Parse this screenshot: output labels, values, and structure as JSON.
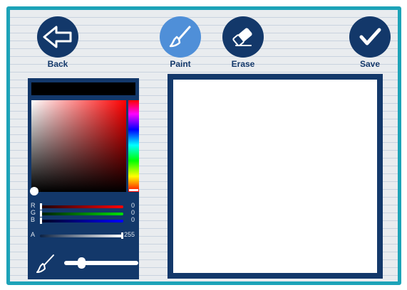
{
  "toolbar": {
    "back_label": "Back",
    "paint_label": "Paint",
    "erase_label": "Erase",
    "save_label": "Save",
    "active_tool": "paint"
  },
  "color_picker": {
    "hex_value": "",
    "channels": [
      {
        "label": "R",
        "value": "0"
      },
      {
        "label": "G",
        "value": "0"
      },
      {
        "label": "B",
        "value": "0"
      },
      {
        "label": "A",
        "value": "255"
      }
    ],
    "brush_size_fraction": 0.2
  },
  "icons": {
    "back": "arrow-left-icon",
    "paint": "paintbrush-icon",
    "erase": "eraser-icon",
    "save": "checkmark-icon",
    "brush_size": "paintbrush-icon"
  },
  "colors": {
    "frame": "#1da3b8",
    "primary": "#13386a",
    "active": "#4f8fd8",
    "paper": "#e9ecef"
  }
}
